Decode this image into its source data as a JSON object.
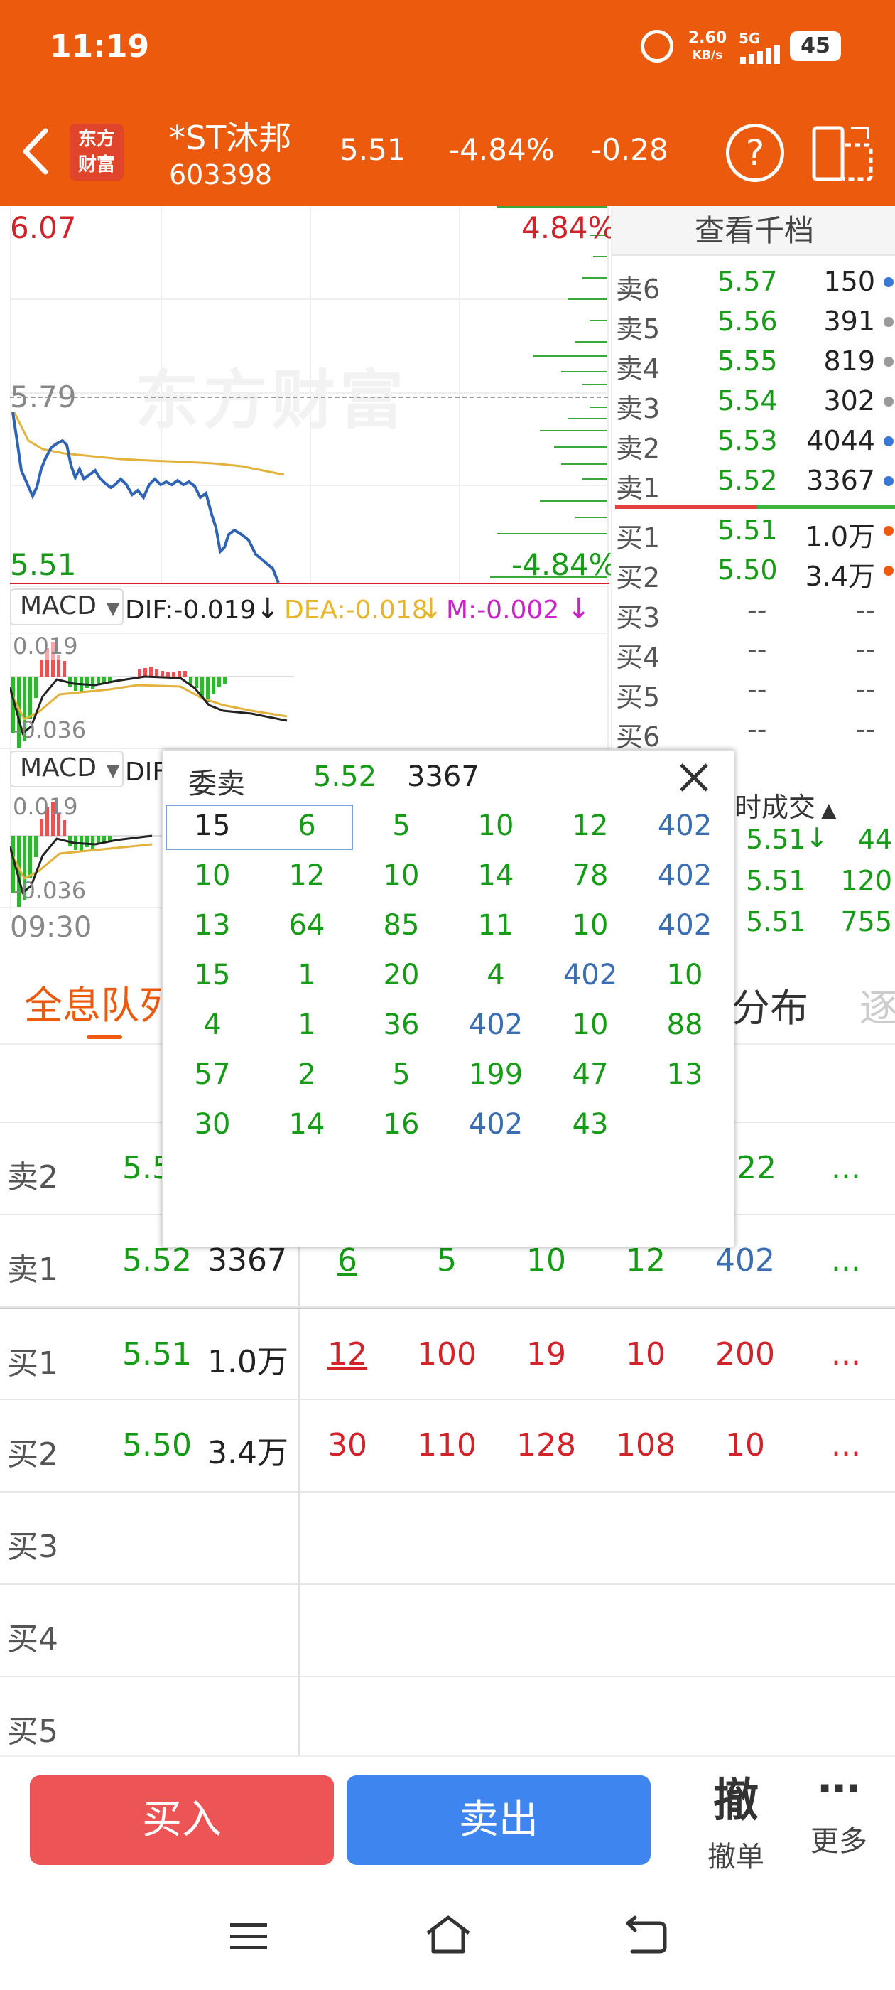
{
  "status": {
    "time": "11:19",
    "speed": "2.60",
    "speed_unit": "KB/s",
    "net": "5G",
    "battery": "45"
  },
  "header": {
    "logo_line1": "东方",
    "logo_line2": "财富",
    "name": "*ST沐邦",
    "code": "603398",
    "price": "5.51",
    "change_pct": "-4.84%",
    "change": "-0.28"
  },
  "chart": {
    "high_price": "6.07",
    "high_pct": "4.84%",
    "prev_close": "5.79",
    "low_price": "5.51",
    "low_pct": "-4.84%",
    "watermark": "东方财富",
    "time_start": "09:30"
  },
  "macd1": {
    "label": "MACD",
    "dif": "DIF:-0.019",
    "dea": "DEA:-0.018",
    "m": "M:-0.002",
    "top_val": "0.019",
    "bot_val": "-0.036"
  },
  "macd2": {
    "label": "MACD",
    "dif": "DIF",
    "top_val": "0.019",
    "bot_val": "-0.036"
  },
  "orderbook": {
    "title": "查看千档",
    "sell": [
      {
        "label": "卖6",
        "price": "5.57",
        "vol": "150"
      },
      {
        "label": "卖5",
        "price": "5.56",
        "vol": "391"
      },
      {
        "label": "卖4",
        "price": "5.55",
        "vol": "819"
      },
      {
        "label": "卖3",
        "price": "5.54",
        "vol": "302"
      },
      {
        "label": "卖2",
        "price": "5.53",
        "vol": "4044"
      },
      {
        "label": "卖1",
        "price": "5.52",
        "vol": "3367"
      }
    ],
    "buy": [
      {
        "label": "买1",
        "price": "5.51",
        "vol": "1.0万"
      },
      {
        "label": "买2",
        "price": "5.50",
        "vol": "3.4万"
      },
      {
        "label": "买3",
        "price": "--",
        "vol": "--"
      },
      {
        "label": "买4",
        "price": "--",
        "vol": "--"
      },
      {
        "label": "买5",
        "price": "--",
        "vol": "--"
      },
      {
        "label": "买6",
        "price": "--",
        "vol": "--"
      }
    ],
    "trades_title": "时成交",
    "trades": [
      {
        "price": "5.51",
        "vol": "44"
      },
      {
        "price": "5.51",
        "vol": "120"
      },
      {
        "price": "5.51",
        "vol": "755"
      }
    ]
  },
  "tabs": {
    "queue": "全息队列",
    "dist": "分布",
    "more": "逐"
  },
  "queue": {
    "sell2": {
      "label": "卖2",
      "price": "5.5",
      "last": "22",
      "more": "..."
    },
    "sell1": {
      "label": "卖1",
      "price": "5.52",
      "vol": "3367",
      "c1": "6",
      "c2": "5",
      "c3": "10",
      "c4": "12",
      "c5": "402",
      "more": "..."
    },
    "buy1": {
      "label": "买1",
      "price": "5.51",
      "vol": "1.0万",
      "c1": "12",
      "c2": "100",
      "c3": "19",
      "c4": "10",
      "c5": "200",
      "more": "..."
    },
    "buy2": {
      "label": "买2",
      "price": "5.50",
      "vol": "3.4万",
      "c1": "30",
      "c2": "110",
      "c3": "128",
      "c4": "108",
      "c5": "10",
      "more": "..."
    },
    "buy3": {
      "label": "买3"
    },
    "buy4": {
      "label": "买4"
    },
    "buy5": {
      "label": "买5"
    }
  },
  "popup": {
    "title": "委卖",
    "price": "5.52",
    "vol": "3367",
    "rows": [
      [
        "15",
        "6",
        "5",
        "10",
        "12",
        "402"
      ],
      [
        "10",
        "12",
        "10",
        "14",
        "78",
        "402"
      ],
      [
        "13",
        "64",
        "85",
        "11",
        "10",
        "402"
      ],
      [
        "15",
        "1",
        "20",
        "4",
        "402",
        "10"
      ],
      [
        "4",
        "1",
        "36",
        "402",
        "10",
        "88"
      ],
      [
        "57",
        "2",
        "5",
        "199",
        "47",
        "13"
      ],
      [
        "30",
        "14",
        "16",
        "402",
        "43",
        ""
      ]
    ]
  },
  "bottom": {
    "buy": "买入",
    "sell": "卖出",
    "cancel_icon": "撤",
    "cancel": "撤单",
    "more": "更多"
  }
}
